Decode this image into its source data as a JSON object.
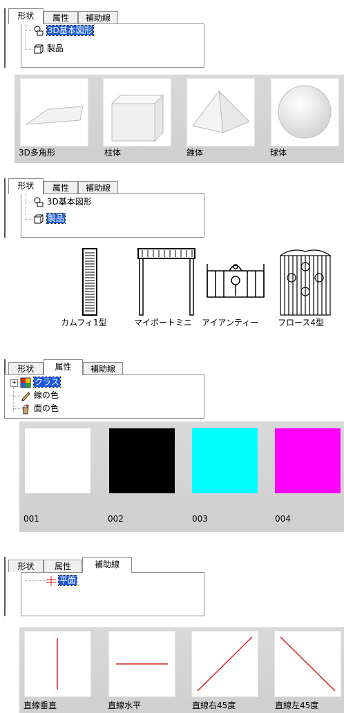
{
  "tabs": [
    "形状",
    "属性",
    "補助線"
  ],
  "panel1": {
    "active_tab": "形状",
    "tree": [
      {
        "label": "3D基本図形",
        "icon": "shapes-icon",
        "selected": true
      },
      {
        "label": "製品",
        "icon": "cube-icon",
        "selected": false
      }
    ]
  },
  "strip1": {
    "items": [
      "3D多角形",
      "柱体",
      "錐体",
      "球体"
    ]
  },
  "panel2": {
    "active_tab": "形状",
    "tree": [
      {
        "label": "3D基本図形",
        "icon": "shapes-icon",
        "selected": false
      },
      {
        "label": "製品",
        "icon": "cube-icon",
        "selected": true
      }
    ]
  },
  "strip2": {
    "items": [
      "カムフィ1型",
      "マイポートミニ",
      "アイアンティー",
      "フロース4型"
    ]
  },
  "panel3": {
    "active_tab": "属性",
    "tree": [
      {
        "label": "クラス",
        "icon": "class-icon",
        "selected": true,
        "expander": "+"
      },
      {
        "label": "線の色",
        "icon": "pencil-icon",
        "selected": false
      },
      {
        "label": "面の色",
        "icon": "paint-bucket-icon",
        "selected": false
      }
    ]
  },
  "strip3": {
    "items": [
      {
        "label": "001",
        "color": "#ffffff"
      },
      {
        "label": "002",
        "color": "#000000"
      },
      {
        "label": "003",
        "color": "#00ffff"
      },
      {
        "label": "004",
        "color": "#ff00ff"
      }
    ]
  },
  "panel4": {
    "active_tab": "補助線",
    "tree": [
      {
        "label": "平面",
        "icon": "guide-line-icon",
        "selected": true
      }
    ]
  },
  "strip4": {
    "items": [
      "直線垂直",
      "直線水平",
      "直線右45度",
      "直線左45度"
    ],
    "line_color": "#d42020"
  }
}
